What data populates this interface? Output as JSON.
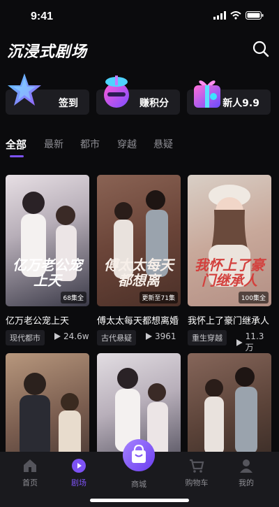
{
  "status_bar": {
    "time": "9:41"
  },
  "header": {
    "title": "沉浸式剧场"
  },
  "quick_actions": [
    {
      "label": "签到",
      "icon": "star-icon"
    },
    {
      "label": "赚积分",
      "icon": "gift-box-icon"
    },
    {
      "label": "新人9.9",
      "icon": "present-icon"
    }
  ],
  "tabs": [
    "全部",
    "最新",
    "都市",
    "穿越",
    "悬疑"
  ],
  "cards": [
    {
      "title": "亿万老公宠上天",
      "tag": "现代都市",
      "views": "24.6w",
      "episodes": "68集全",
      "poster_title": "亿万老公宠上天",
      "colors": [
        "#3b3a48",
        "#e7dfe4"
      ]
    },
    {
      "title": "傅太太每天都想离婚",
      "tag": "古代悬疑",
      "views": "3961",
      "episodes": "更新至71集",
      "poster_title": "傅太太每天都想离",
      "colors": [
        "#4b3028",
        "#8a6354"
      ]
    },
    {
      "title": "我怀上了豪门继承人",
      "tag": "重生穿越",
      "views": "11.3万",
      "episodes": "100集全",
      "poster_title": "我怀上了豪门继承人",
      "colors": [
        "#d9cfc6",
        "#b38f84"
      ]
    },
    {
      "title": "",
      "tag": "",
      "views": "",
      "episodes": "",
      "poster_title": "",
      "colors": [
        "#3a2e2c",
        "#b7977d"
      ]
    },
    {
      "title": "",
      "tag": "",
      "views": "",
      "episodes": "",
      "poster_title": "",
      "colors": [
        "#3b3a48",
        "#e2dde2"
      ]
    },
    {
      "title": "",
      "tag": "",
      "views": "",
      "episodes": "",
      "poster_title": "",
      "colors": [
        "#2d2420",
        "#86665a"
      ]
    }
  ],
  "tabbar": [
    {
      "label": "首页",
      "icon": "home-icon"
    },
    {
      "label": "剧场",
      "icon": "theater-play-icon"
    },
    {
      "label": "商城",
      "icon": "shopping-bag-icon"
    },
    {
      "label": "购物车",
      "icon": "cart-icon"
    },
    {
      "label": "我的",
      "icon": "user-icon"
    }
  ],
  "colors": {
    "accent": "#7d52f4",
    "background": "#0b0b0d",
    "card": "#1d1d22"
  }
}
